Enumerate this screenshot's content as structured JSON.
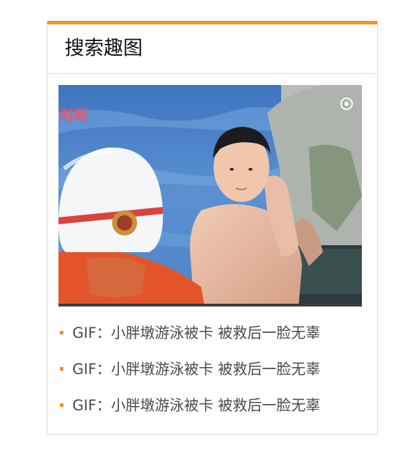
{
  "widget": {
    "title": "搜索趣图",
    "accent_color": "#ff8a1f",
    "border_color": "#d4dee9",
    "image": {
      "watermark_text": "时间",
      "description_icon": "play-icon"
    },
    "items": [
      {
        "label": "GIF：小胖墩游泳被卡 被救后一脸无辜"
      },
      {
        "label": "GIF：小胖墩游泳被卡 被救后一脸无辜"
      },
      {
        "label": "GIF：小胖墩游泳被卡 被救后一脸无辜"
      }
    ]
  }
}
